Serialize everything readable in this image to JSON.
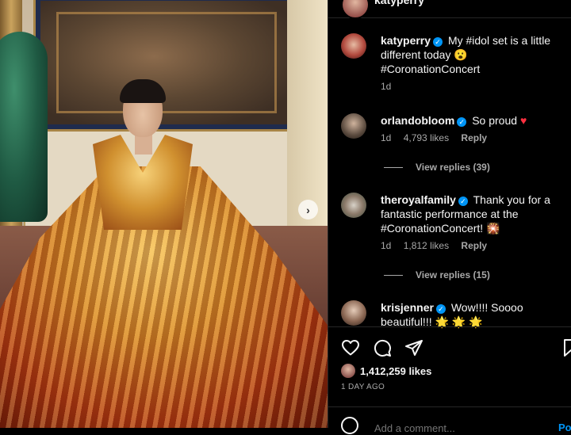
{
  "photo": {
    "next_glyph": "›"
  },
  "header": {
    "username": "katyperry"
  },
  "caption": {
    "username": "katyperry",
    "text": "My #idol set is a little different today 😮 #CoronationConcert",
    "time": "1d"
  },
  "comments": [
    {
      "username": "orlandobloom",
      "text": "So proud",
      "emoji": "♥",
      "time": "1d",
      "likes": "4,793 likes",
      "reply_label": "Reply",
      "view_replies": "View replies (39)"
    },
    {
      "username": "theroyalfamily",
      "text": "Thank you for a fantastic performance at the #CoronationConcert! 🎇",
      "time": "1d",
      "likes": "1,812 likes",
      "reply_label": "Reply",
      "view_replies": "View replies (15)"
    },
    {
      "username": "krisjenner",
      "text": "Wow!!!! Soooo beautiful!!! 🌟 🌟 🌟"
    }
  ],
  "actions": {
    "likes": "1,412,259 likes",
    "date": "1 DAY AGO"
  },
  "comment_bar": {
    "placeholder": "Add a comment...",
    "post_label": "Post"
  },
  "colors": {
    "verified": "#0095f6",
    "heart": "#ff3040",
    "muted": "#a8a8a8"
  }
}
